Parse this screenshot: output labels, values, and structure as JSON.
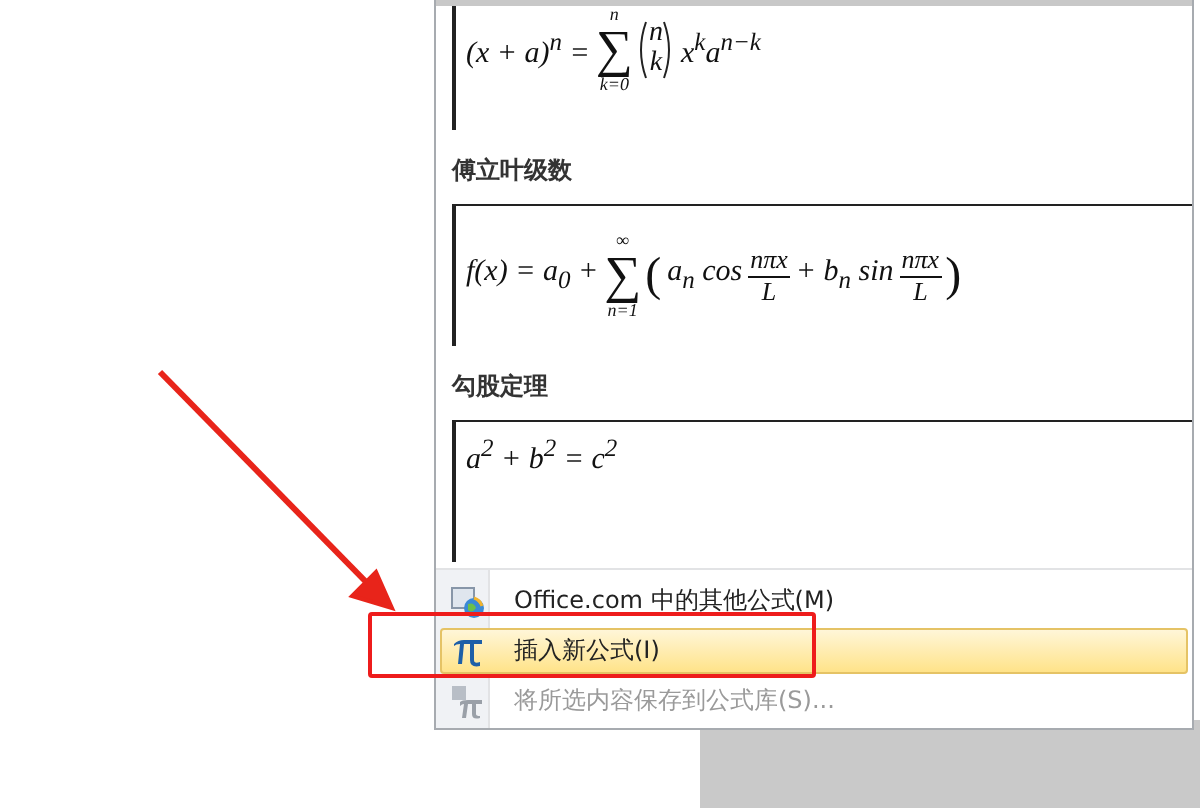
{
  "equations": [
    {
      "tokens": [
        {
          "kind": "text",
          "text": "(x + a)$^{n}$ ="
        },
        {
          "kind": "sum",
          "symbol": "∑",
          "upper": "n",
          "lower": "k=0"
        },
        {
          "kind": "binom",
          "top": "n",
          "bottom": "k"
        },
        {
          "kind": "text",
          "text": "x$^{k}$a$^{n−k}$"
        }
      ]
    },
    {
      "title": "傅立叶级数",
      "tokens": [
        {
          "kind": "text",
          "text": "f(x) = a$_{0}$ +"
        },
        {
          "kind": "sum",
          "symbol": "∑",
          "upper": "∞",
          "lower": "n=1"
        },
        {
          "kind": "delim",
          "text": "("
        },
        {
          "kind": "text",
          "text": "a$_{n}$ cos"
        },
        {
          "kind": "frac",
          "top": "nπx",
          "bottom": "L"
        },
        {
          "kind": "text",
          "text": "+ b$_{n}$ sin"
        },
        {
          "kind": "frac",
          "top": "nπx",
          "bottom": "L"
        },
        {
          "kind": "delim",
          "text": ")"
        }
      ]
    },
    {
      "title": "勾股定理",
      "tokens": [
        {
          "kind": "text",
          "text": "a$^{2}$ + b$^{2}$ = c$^{2}$"
        }
      ]
    }
  ],
  "menu": [
    {
      "kind": "online",
      "label": "Office.com 中的其他公式(M)",
      "highlighted": false,
      "disabled": false
    },
    {
      "kind": "insert",
      "label": "插入新公式(I)",
      "highlighted": true,
      "disabled": false
    },
    {
      "kind": "save",
      "label": "将所选内容保存到公式库(S)...",
      "highlighted": false,
      "disabled": true
    }
  ]
}
